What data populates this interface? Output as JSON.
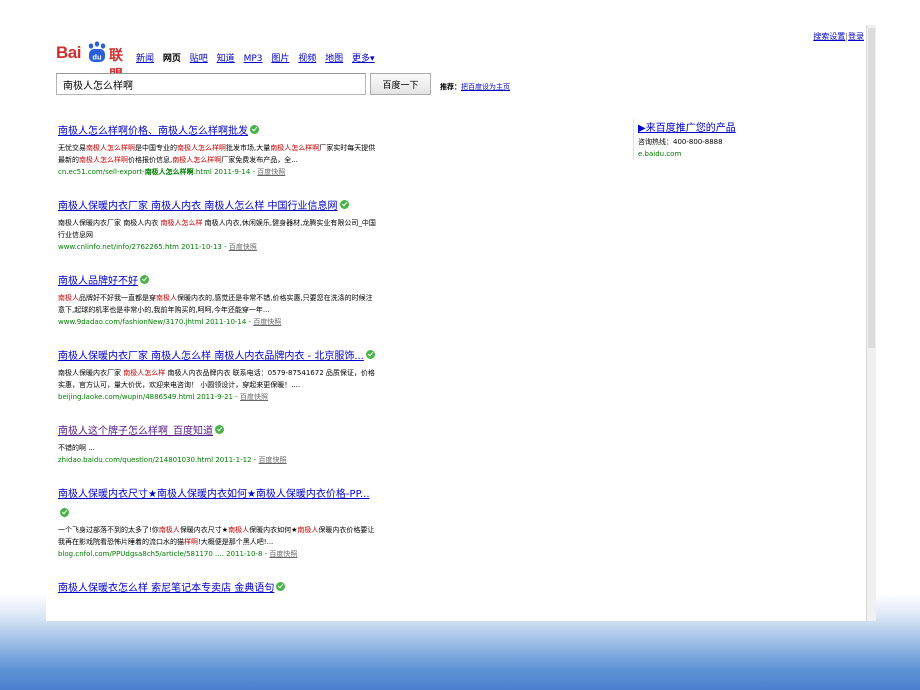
{
  "top_links": {
    "settings": "搜索设置",
    "separator": "|",
    "login": "登录"
  },
  "logo": {
    "bai": "Bai",
    "du": "du",
    "suffix": "联盟"
  },
  "nav": [
    "新闻",
    "网页",
    "贴吧",
    "知道",
    "MP3",
    "图片",
    "视频",
    "地图",
    "更多▾"
  ],
  "nav_active_index": 1,
  "search": {
    "query": "南极人怎么样啊",
    "button": "百度一下"
  },
  "recommend": {
    "label": "推荐：",
    "link": "把百度设为主页"
  },
  "results": [
    {
      "title": [
        [
          "南极人怎么样啊价格",
          1
        ],
        [
          "、",
          0
        ],
        [
          "南极人怎么样啊批发",
          1
        ]
      ],
      "visited": false,
      "desc": [
        [
          "无忧交易",
          0
        ],
        [
          "南极人怎么样啊",
          1
        ],
        [
          "是中国专业的",
          0
        ],
        [
          "南极人怎么样啊",
          1
        ],
        [
          "批发市场,大量",
          0
        ],
        [
          "南极人怎么样啊",
          1
        ],
        [
          "厂家实时每天提供最新的",
          0
        ],
        [
          "南极人怎么样啊",
          1
        ],
        [
          "价格报价信息,",
          0
        ],
        [
          "南极人怎么样啊",
          1
        ],
        [
          "厂家免费发布产品，全...",
          0
        ]
      ],
      "url": [
        [
          "cn.ec51.com/sell-export-",
          0
        ],
        [
          "南极人怎么样啊",
          1
        ],
        [
          ".html 2011-9-14 - ",
          0
        ]
      ],
      "cache": "百度快照"
    },
    {
      "title": [
        [
          "南极人保暖内衣厂家 南极人内衣 南极人怎么样 中国行业信息网",
          1
        ]
      ],
      "visited": false,
      "desc": [
        [
          "南极人保暖内衣厂家 南极人内衣 ",
          0
        ],
        [
          "南极人怎么样",
          1
        ],
        [
          " 南极人内衣,休闲娱乐,健身器材,龙腾实业有限公司_中国行业信息网",
          0
        ]
      ],
      "url": [
        [
          "www.cnlinfo.net/info/2762265.htm 2011-10-13 - ",
          0
        ]
      ],
      "cache": "百度快照"
    },
    {
      "title": [
        [
          "南极人品牌好不好",
          1
        ]
      ],
      "visited": false,
      "desc": [
        [
          "南极人",
          1
        ],
        [
          "品牌好不好我一直都是穿",
          0
        ],
        [
          "南极人",
          1
        ],
        [
          "保暖内衣的,感觉还是非常不错,价格实惠,只要您在洗涤的时候注意下,起球的机率也是非常小的,我前年购买的,呵呵,今年还能穿一年...",
          0
        ]
      ],
      "url": [
        [
          "www.9dadao.com/fashionNew/3170.jhtml 2011-10-14 - ",
          0
        ]
      ],
      "cache": "百度快照"
    },
    {
      "title": [
        [
          "南极人保暖内衣厂家 南极人怎么样 南极人内衣品牌内衣 - 北京服饰...",
          1
        ]
      ],
      "visited": false,
      "desc": [
        [
          "南极人保暖内衣厂家 ",
          0
        ],
        [
          "南极人怎么样",
          1
        ],
        [
          " 南极人内衣品牌内衣 联系电话：0579-87541672 品质保证，价格实惠，官方认可，量大价优，欢迎来电咨询！ 小圆领设计，穿起来更保暖！....",
          0
        ]
      ],
      "url": [
        [
          "beijing.laoke.com/wupin/4886549.html 2011-9-21 - ",
          0
        ]
      ],
      "cache": "百度快照"
    },
    {
      "title": [
        [
          "南极人这个牌子怎么样啊_百度知道",
          1
        ]
      ],
      "visited": true,
      "desc": [
        [
          "不错的啊 ...",
          0
        ]
      ],
      "url": [
        [
          "zhidao.baidu.com/question/214801030.html 2011-1-12 - ",
          0
        ]
      ],
      "cache": "百度快照"
    },
    {
      "title": [
        [
          "南极人保暖内衣尺寸★南极人保暖内衣如何★南极人保暖内衣价格-PP...",
          1
        ]
      ],
      "visited": false,
      "desc": [
        [
          "一个飞身过部落不到的太多了!你",
          0
        ],
        [
          "南极人",
          1
        ],
        [
          "保暖内衣尺寸★",
          0
        ],
        [
          "南极人",
          1
        ],
        [
          "保暖内衣如何★",
          0
        ],
        [
          "南极人",
          1
        ],
        [
          "保暖内衣价格要让我再在影戏院看恐怖片睡着的流口水的猫",
          0
        ],
        [
          "样啊",
          1
        ],
        [
          "!大概便是那个黑人吧!...",
          0
        ]
      ],
      "url": [
        [
          "blog.cnfol.com/PPUdgsa8ch5/article/581170 .... 2011-10-8 - ",
          0
        ]
      ],
      "cache": "百度快照"
    },
    {
      "title": [
        [
          "南极人保暖衣怎么样 索尼笔记本专卖店 金典语句",
          1
        ]
      ],
      "visited": false,
      "desc": [],
      "url": [],
      "cache": ""
    }
  ],
  "ad": {
    "title": "来百度推广您的产品",
    "phone": "咨询热线：400-800-8888",
    "url": "e.baidu.com"
  }
}
